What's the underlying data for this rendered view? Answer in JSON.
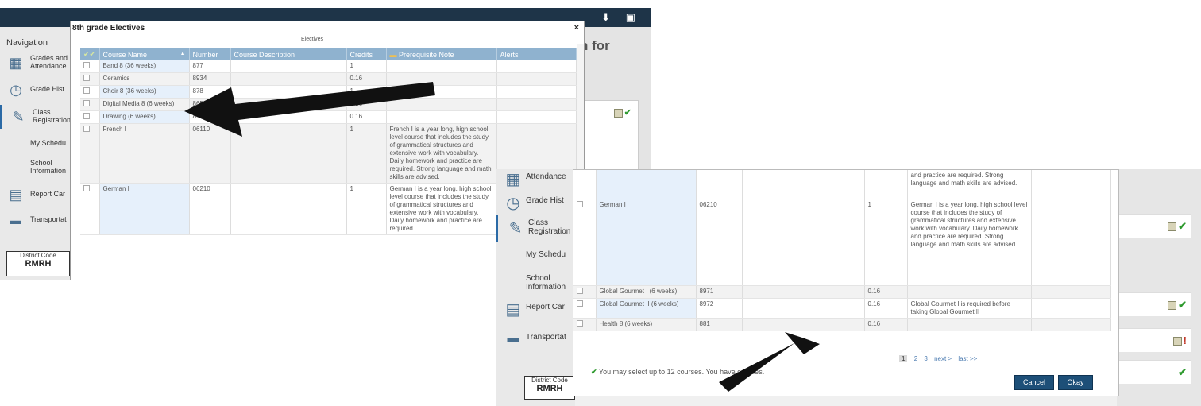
{
  "shot1": {
    "nav": {
      "title": "Navigation",
      "items": [
        {
          "icon": "grades-icon",
          "label": "Grades and Attendance"
        },
        {
          "icon": "grade-history-icon",
          "label": "Grade Hist"
        },
        {
          "icon": "class-registration-icon",
          "label": "Class Registration"
        },
        {
          "icon": "",
          "label": "My Schedu"
        },
        {
          "icon": "",
          "label": "School Information"
        },
        {
          "icon": "report-card-icon",
          "label": "Report Car"
        },
        {
          "icon": "bus-icon",
          "label": "Transportat"
        }
      ],
      "district_code_label": "District Code",
      "district_code": "RMRH"
    },
    "background_title": "n for",
    "modal": {
      "title": "8th grade Electives",
      "close": "×",
      "caption": "Electives",
      "columns": [
        "",
        "Course Name",
        "Number",
        "Course Description",
        "Credits",
        "Prerequisite Note",
        "Alerts"
      ],
      "rows": [
        {
          "name": "Band 8 (36 weeks)",
          "number": "877",
          "description": "",
          "credits": "1",
          "note": ""
        },
        {
          "name": "Ceramics",
          "number": "8934",
          "description": "",
          "credits": "0.16",
          "note": ""
        },
        {
          "name": "Choir 8 (36 weeks)",
          "number": "878",
          "description": "",
          "credits": "1",
          "note": ""
        },
        {
          "name": "Digital Media 8 (6 weeks)",
          "number": "8652",
          "description": "",
          "credits": "0.16",
          "note": ""
        },
        {
          "name": "Drawing (6 weeks)",
          "number": "8932",
          "description": "",
          "credits": "0.16",
          "note": ""
        },
        {
          "name": "French I",
          "number": "06110",
          "description": "",
          "credits": "1",
          "note": "French I is a year long, high school level course that includes the study of grammatical structures and extensive work with vocabulary. Daily homework and practice are required. Strong language and math skills are advised."
        },
        {
          "name": "German I",
          "number": "06210",
          "description": "",
          "credits": "1",
          "note": "German I is a year long, high school level course that includes the study of grammatical structures and extensive work with vocabulary. Daily homework and practice are required."
        }
      ]
    }
  },
  "shot2": {
    "nav": {
      "items": [
        {
          "icon": "grades-icon",
          "label": "Attendance"
        },
        {
          "icon": "grade-history-icon",
          "label": "Grade Hist"
        },
        {
          "icon": "class-registration-icon",
          "label": "Class Registration"
        },
        {
          "icon": "",
          "label": "My Schedu"
        },
        {
          "icon": "",
          "label": "School Information"
        },
        {
          "icon": "report-card-icon",
          "label": "Report Car"
        },
        {
          "icon": "bus-icon",
          "label": "Transportat"
        }
      ],
      "district_code_label": "District Code",
      "district_code": "RMRH"
    },
    "modal": {
      "top_note": "and practice are required. Strong language and math skills are advised.",
      "rows": [
        {
          "name": "German I",
          "number": "06210",
          "description": "",
          "credits": "1",
          "note": "German I is a year long, high school level course that includes the study of grammatical structures and extensive work with vocabulary. Daily homework and practice are required. Strong language and math skills are advised."
        },
        {
          "name": "Global Gourmet I (6 weeks)",
          "number": "8971",
          "description": "",
          "credits": "0.16",
          "note": ""
        },
        {
          "name": "Global Gourmet II (6 weeks)",
          "number": "8972",
          "description": "",
          "credits": "0.16",
          "note": "Global Gourmet I is required before taking Global Gourmet II"
        },
        {
          "name": "Health 8 (6 weeks)",
          "number": "881",
          "description": "",
          "credits": "0.16",
          "note": ""
        }
      ],
      "pager": {
        "current": "1",
        "page2": "2",
        "page3": "3",
        "next": "next >",
        "last": "last >>"
      },
      "footer_message": "You may select up to 12 courses. You have                  courses.",
      "cancel_label": "Cancel",
      "okay_label": "Okay"
    },
    "status_marks": [
      "✔",
      "✔",
      "!",
      "✔"
    ]
  },
  "colors": {
    "header": "#1e3448",
    "table_header": "#8fb2cf",
    "button": "#1d4f78",
    "check": "#2e9a2e",
    "alert": "#c0392b"
  }
}
